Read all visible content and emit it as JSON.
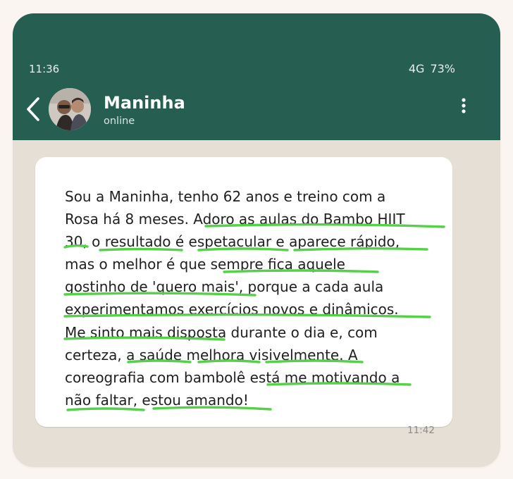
{
  "status_bar": {
    "time": "11:36",
    "network": "4G",
    "battery": "73%"
  },
  "header": {
    "contact_name": "Maninha",
    "contact_status": "online"
  },
  "message": {
    "text": "Sou a Maninha, tenho 62 anos e treino com a\nRosa há 8 meses. Adoro as aulas do Bambo HIIT\n30, o resultado é espetacular e aparece rápido,\nmas o melhor é que sempre fica aquele\ngostinho de 'quero mais', porque a cada aula\nexperimentamos exercícios novos e dinâmicos.\nMe sinto mais disposta durante o dia e, com\ncerteza, a saúde melhora visivelmente. A\ncoreografia com bambolê está me motivando a\nnão faltar, estou amando!",
    "time": "11:42"
  },
  "colors": {
    "header": "#265e52",
    "chat_background": "#e6dfd5",
    "bubble": "#ffffff",
    "underline": "#56d04a"
  },
  "icons": {
    "back": "chevron-left-icon",
    "menu": "more-vertical-icon"
  }
}
